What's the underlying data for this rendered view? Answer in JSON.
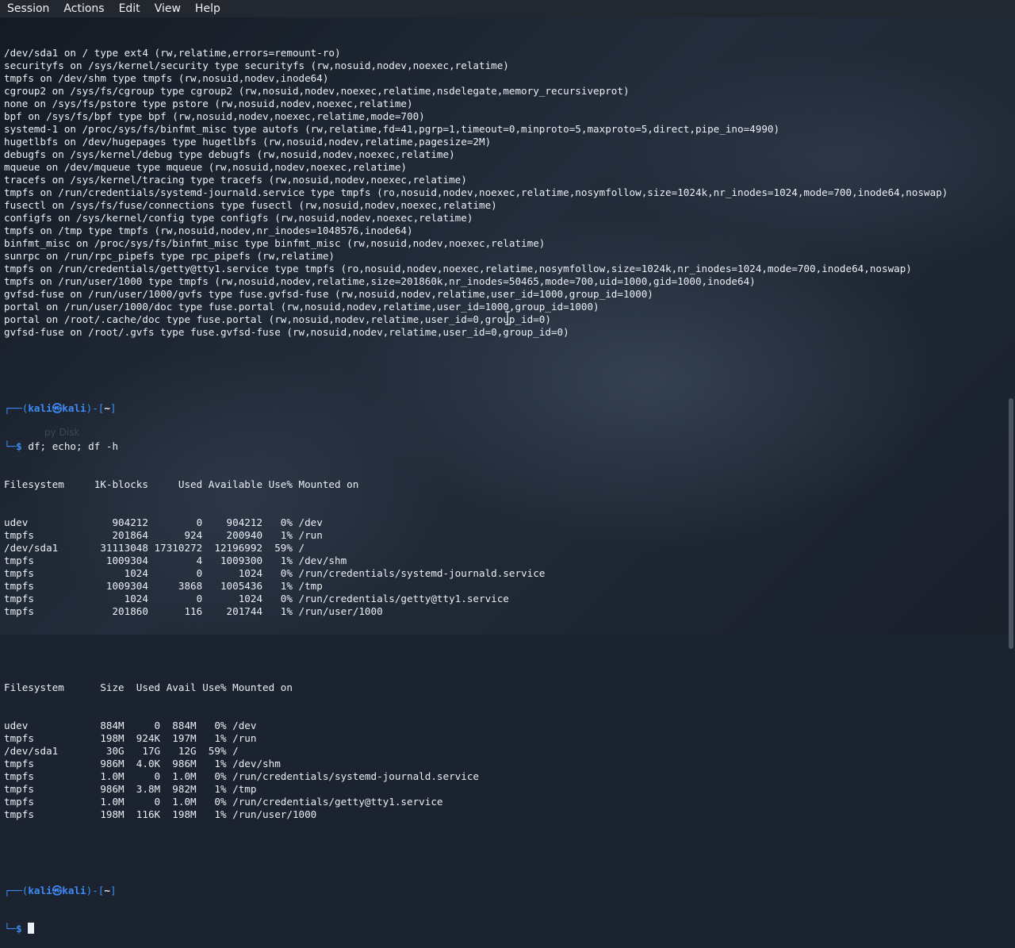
{
  "menubar": {
    "items": [
      "Session",
      "Actions",
      "Edit",
      "View",
      "Help"
    ]
  },
  "desktop": {
    "label": "py Disk"
  },
  "mount_output": [
    "/dev/sda1 on / type ext4 (rw,relatime,errors=remount-ro)",
    "securityfs on /sys/kernel/security type securityfs (rw,nosuid,nodev,noexec,relatime)",
    "tmpfs on /dev/shm type tmpfs (rw,nosuid,nodev,inode64)",
    "cgroup2 on /sys/fs/cgroup type cgroup2 (rw,nosuid,nodev,noexec,relatime,nsdelegate,memory_recursiveprot)",
    "none on /sys/fs/pstore type pstore (rw,nosuid,nodev,noexec,relatime)",
    "bpf on /sys/fs/bpf type bpf (rw,nosuid,nodev,noexec,relatime,mode=700)",
    "systemd-1 on /proc/sys/fs/binfmt_misc type autofs (rw,relatime,fd=41,pgrp=1,timeout=0,minproto=5,maxproto=5,direct,pipe_ino=4990)",
    "hugetlbfs on /dev/hugepages type hugetlbfs (rw,nosuid,nodev,relatime,pagesize=2M)",
    "debugfs on /sys/kernel/debug type debugfs (rw,nosuid,nodev,noexec,relatime)",
    "mqueue on /dev/mqueue type mqueue (rw,nosuid,nodev,noexec,relatime)",
    "tracefs on /sys/kernel/tracing type tracefs (rw,nosuid,nodev,noexec,relatime)",
    "tmpfs on /run/credentials/systemd-journald.service type tmpfs (ro,nosuid,nodev,noexec,relatime,nosymfollow,size=1024k,nr_inodes=1024,mode=700,inode64,noswap)",
    "fusectl on /sys/fs/fuse/connections type fusectl (rw,nosuid,nodev,noexec,relatime)",
    "configfs on /sys/kernel/config type configfs (rw,nosuid,nodev,noexec,relatime)",
    "tmpfs on /tmp type tmpfs (rw,nosuid,nodev,nr_inodes=1048576,inode64)",
    "binfmt_misc on /proc/sys/fs/binfmt_misc type binfmt_misc (rw,nosuid,nodev,noexec,relatime)",
    "sunrpc on /run/rpc_pipefs type rpc_pipefs (rw,relatime)",
    "tmpfs on /run/credentials/getty@tty1.service type tmpfs (ro,nosuid,nodev,noexec,relatime,nosymfollow,size=1024k,nr_inodes=1024,mode=700,inode64,noswap)",
    "tmpfs on /run/user/1000 type tmpfs (rw,nosuid,nodev,relatime,size=201860k,nr_inodes=50465,mode=700,uid=1000,gid=1000,inode64)",
    "gvfsd-fuse on /run/user/1000/gvfs type fuse.gvfsd-fuse (rw,nosuid,nodev,relatime,user_id=1000,group_id=1000)",
    "portal on /run/user/1000/doc type fuse.portal (rw,nosuid,nodev,relatime,user_id=1000,group_id=1000)",
    "portal on /root/.cache/doc type fuse.portal (rw,nosuid,nodev,relatime,user_id=0,group_id=0)",
    "gvfsd-fuse on /root/.gvfs type fuse.gvfsd-fuse (rw,nosuid,nodev,relatime,user_id=0,group_id=0)"
  ],
  "prompt": {
    "open": "┌──(",
    "user": "kali",
    "at": "㉿",
    "host": "kali",
    "mid": ")-[",
    "dir": "~",
    "close": "]",
    "dollar_prefix": "└─",
    "dollar": "$"
  },
  "command": "df; echo; df -h",
  "df_table": {
    "header": "Filesystem     1K-blocks     Used Available Use% Mounted on",
    "rows": [
      "udev              904212        0    904212   0% /dev",
      "tmpfs             201864      924    200940   1% /run",
      "/dev/sda1       31113048 17310272  12196992  59% /",
      "tmpfs            1009304        4   1009300   1% /dev/shm",
      "tmpfs               1024        0      1024   0% /run/credentials/systemd-journald.service",
      "tmpfs            1009304     3868   1005436   1% /tmp",
      "tmpfs               1024        0      1024   0% /run/credentials/getty@tty1.service",
      "tmpfs             201860      116    201744   1% /run/user/1000"
    ]
  },
  "df_h_table": {
    "header": "Filesystem      Size  Used Avail Use% Mounted on",
    "rows": [
      "udev            884M     0  884M   0% /dev",
      "tmpfs           198M  924K  197M   1% /run",
      "/dev/sda1        30G   17G   12G  59% /",
      "tmpfs           986M  4.0K  986M   1% /dev/shm",
      "tmpfs           1.0M     0  1.0M   0% /run/credentials/systemd-journald.service",
      "tmpfs           986M  3.8M  982M   1% /tmp",
      "tmpfs           1.0M     0  1.0M   0% /run/credentials/getty@tty1.service",
      "tmpfs           198M  116K  198M   1% /run/user/1000"
    ]
  },
  "colors": {
    "prompt_blue": "#3e8cf7",
    "terminal_text": "#eceff4",
    "menubar_bg": "#232830"
  }
}
